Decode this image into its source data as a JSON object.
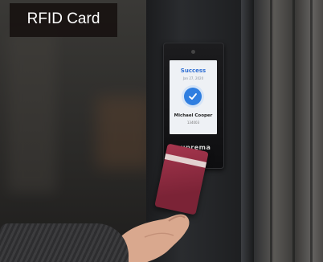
{
  "caption": {
    "label": "RFID Card"
  },
  "device": {
    "screen_status": "Success",
    "screen_date": "Jan 27, 2020",
    "user_name": "Michael Cooper",
    "user_id": "134003",
    "brand": "suprema",
    "icon": "check-icon"
  },
  "colors": {
    "caption_bg": "#140e0c",
    "accent": "#2f7ee0",
    "card": "#a6364e"
  }
}
